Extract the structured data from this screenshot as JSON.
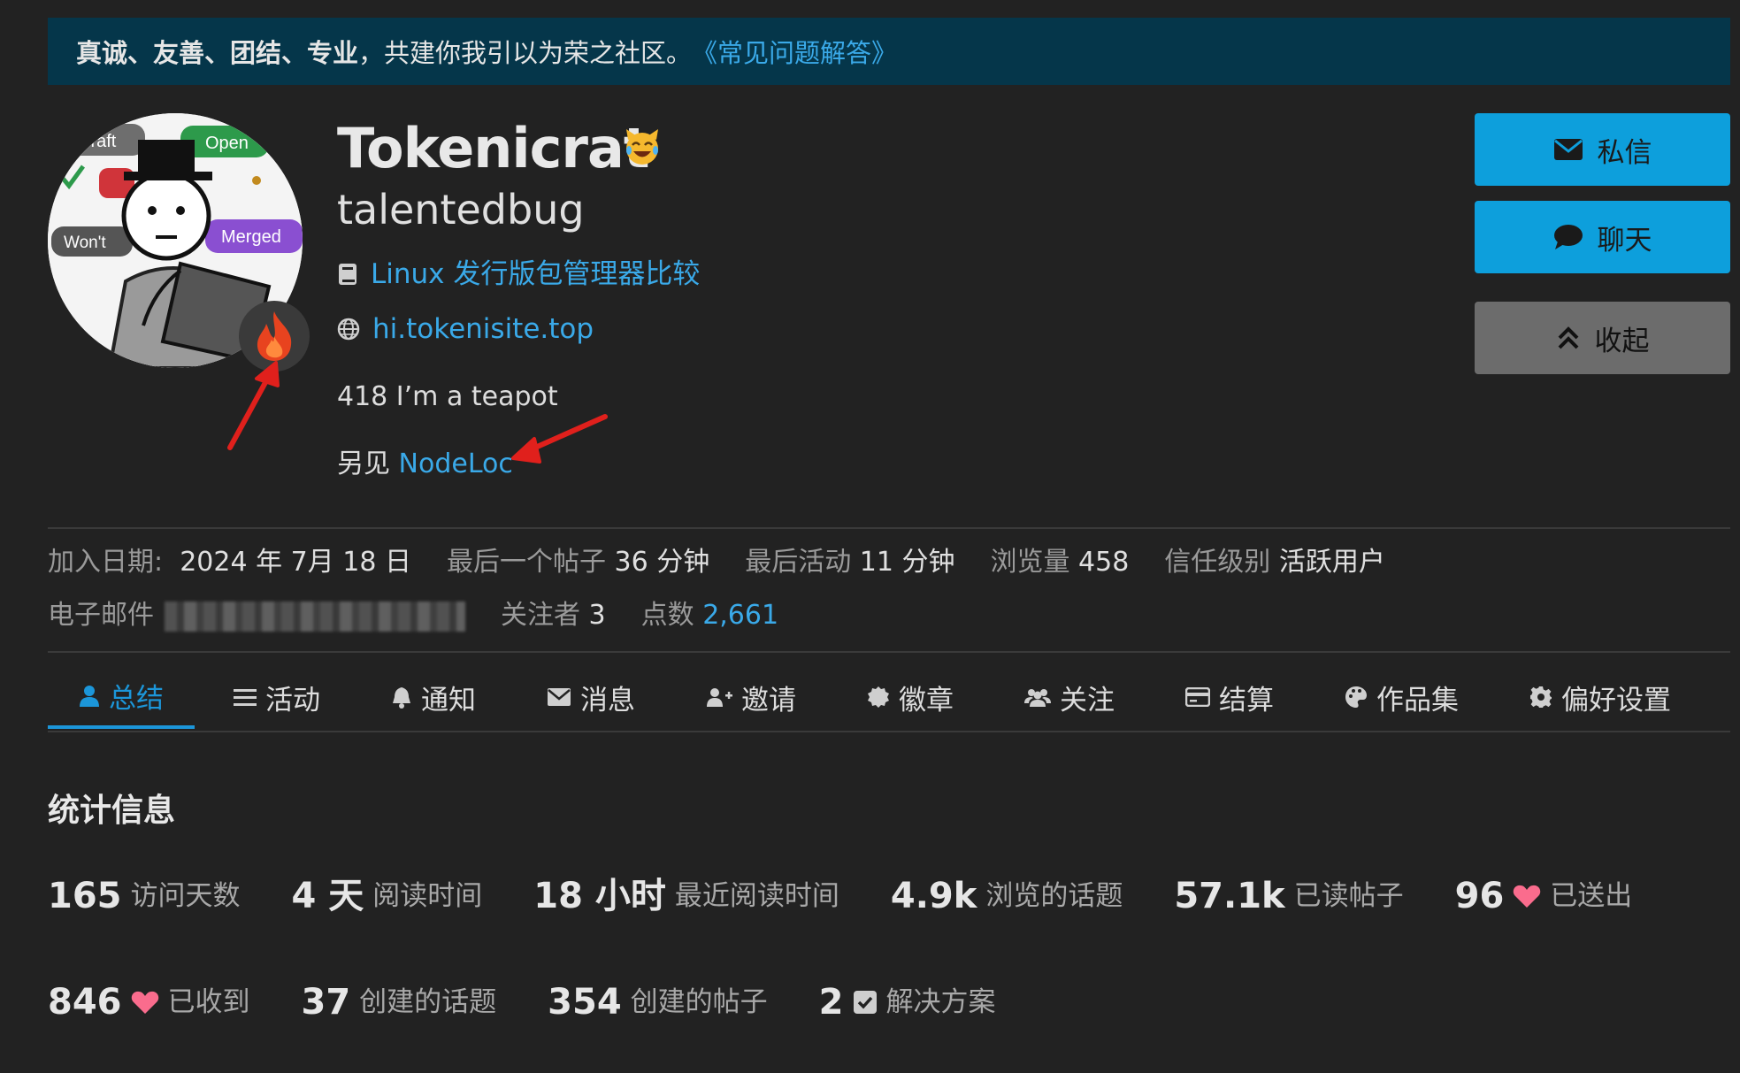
{
  "banner": {
    "bold_text": "真诚、友善、团结、专业",
    "plain_text": "，共建你我引以为荣之社区。",
    "link_text": "《常见问题解答》"
  },
  "profile": {
    "username": "Tokenicrat",
    "status_emoji": "😹",
    "full_name": "talentedbug",
    "title": "Linux 发行版包管理器比较",
    "website": "hi.tokenisite.top",
    "bio_line1": "418 I’m a teapot",
    "bio_line2_prefix": "另见 ",
    "bio_line2_link": "NodeLoc",
    "avatar_tags": [
      "Draft",
      "Open",
      "Won't",
      "Merged"
    ]
  },
  "actions": {
    "message_label": "私信",
    "chat_label": "聊天",
    "collapse_label": "收起"
  },
  "meta": {
    "joined_label": "加入日期:",
    "joined_value": "2024 年 7月 18 日",
    "last_post_label": "最后一个帖子",
    "last_post_value": "36 分钟",
    "last_active_label": "最后活动",
    "last_active_value": "11 分钟",
    "views_label": "浏览量",
    "views_value": "458",
    "trust_label": "信任级别",
    "trust_value": "活跃用户",
    "email_label": "电子邮件",
    "followers_label": "关注者",
    "followers_value": "3",
    "points_label": "点数",
    "points_value": "2,661"
  },
  "nav": {
    "tabs": [
      {
        "label": "总结",
        "icon": "user-icon"
      },
      {
        "label": "活动",
        "icon": "list-icon"
      },
      {
        "label": "通知",
        "icon": "bell-icon"
      },
      {
        "label": "消息",
        "icon": "envelope-icon"
      },
      {
        "label": "邀请",
        "icon": "user-plus-icon"
      },
      {
        "label": "徽章",
        "icon": "badge-icon"
      },
      {
        "label": "关注",
        "icon": "users-icon"
      },
      {
        "label": "结算",
        "icon": "credit-card-icon"
      },
      {
        "label": "作品集",
        "icon": "palette-icon"
      },
      {
        "label": "偏好设置",
        "icon": "gear-icon"
      }
    ],
    "active_index": 0
  },
  "stats": {
    "title": "统计信息",
    "row1": [
      {
        "num": "165",
        "label": "访问天数"
      },
      {
        "num": "4 天",
        "label": "阅读时间"
      },
      {
        "num": "18 小时",
        "label": "最近阅读时间"
      },
      {
        "num": "4.9k",
        "label": "浏览的话题"
      },
      {
        "num": "57.1k",
        "label": "已读帖子"
      },
      {
        "num": "96",
        "label": "已送出",
        "icon": "heart-icon"
      }
    ],
    "row2": [
      {
        "num": "846",
        "label": "已收到",
        "icon": "heart-icon"
      },
      {
        "num": "37",
        "label": "创建的话题"
      },
      {
        "num": "354",
        "label": "创建的帖子"
      },
      {
        "num": "2",
        "label": "解决方案",
        "icon": "checkbox-icon"
      }
    ]
  },
  "colors": {
    "background": "#222222",
    "banner_bg": "#05364a",
    "accent": "#0d9fdc",
    "link": "#3aa9e8",
    "heart": "#fa6c8d",
    "annotation": "#e0201c"
  }
}
